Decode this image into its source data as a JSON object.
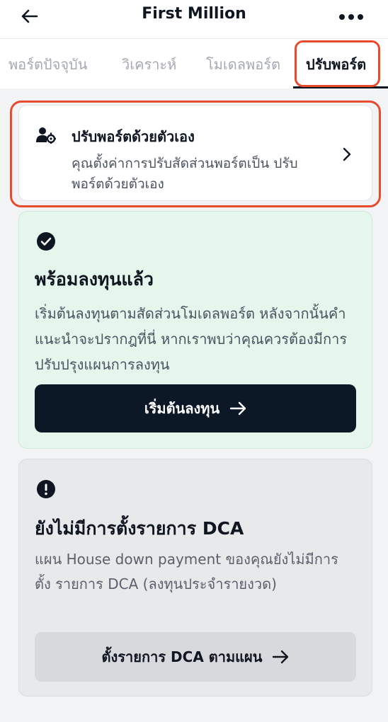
{
  "header": {
    "title": "First Million",
    "back_icon": "arrow-left-icon",
    "more_icon": "more-horizontal-icon"
  },
  "tabs": [
    {
      "label": "พอร์ตปัจจุบัน",
      "active": false
    },
    {
      "label": "วิเคราะห์",
      "active": false
    },
    {
      "label": "โมเดลพอร์ต",
      "active": false
    },
    {
      "label": "ปรับพอร์ต",
      "active": true
    }
  ],
  "manual_card": {
    "icon": "user-gear-icon",
    "title": "ปรับพอร์ตด้วยตัวเอง",
    "description": "คุณตั้งค่าการปรับสัดส่วนพอร์ตเป็น ปรับพอร์ตด้วยตัวเอง",
    "chevron_icon": "chevron-right-icon"
  },
  "ready_card": {
    "icon": "check-circle-icon",
    "title": "พร้อมลงทุนแล้ว",
    "description": "เริ่มต้นลงทุนตามสัดส่วนโมเดลพอร์ต หลังจากนั้นคำแนะนำจะปรากฎที่นี่ หากเราพบว่าคุณควรต้องมีการปรับปรุงแผนการลงทุน",
    "button_label": "เริ่มต้นลงทุน",
    "button_icon": "arrow-right-icon"
  },
  "dca_card": {
    "icon": "exclamation-circle-icon",
    "title": "ยังไม่มีการตั้งรายการ DCA",
    "description": "แผน House down payment ของคุณยังไม่มีการตั้ง รายการ DCA (ลงทุนประจำรายงวด)",
    "button_label": "ตั้งรายการ DCA ตามแผน",
    "button_icon": "arrow-right-icon"
  },
  "colors": {
    "highlight": "#e84a2d",
    "dark_button": "#0c1826",
    "ready_bg": "#e5f6ec",
    "dca_bg": "#e8e9eb"
  }
}
